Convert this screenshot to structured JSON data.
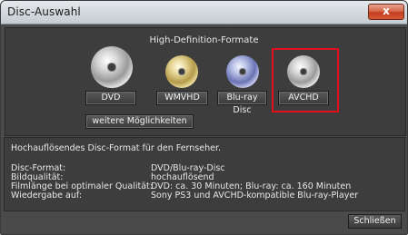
{
  "window": {
    "title": "Disc-Auswahl",
    "close_glyph": "x"
  },
  "formats": {
    "group_label": "High-Definition-Formate",
    "items": [
      {
        "label": "DVD",
        "icon": "silver-disc-icon"
      },
      {
        "label": "WMVHD",
        "icon": "gold-disc-icon"
      },
      {
        "label": "Blu-ray Disc",
        "icon": "blue-disc-icon"
      },
      {
        "label": "AVCHD",
        "icon": "silver-disc-icon",
        "selected": true
      }
    ],
    "more_label": "weitere Möglichkeiten",
    "highlight_color": "#e0101a"
  },
  "info": {
    "description": "Hochauflösendes Disc-Format für den Fernseher.",
    "rows": [
      {
        "label": "Disc-Format:",
        "value": "DVD/Blu-ray-Disc"
      },
      {
        "label": "Bildqualität:",
        "value": "hochauflösend"
      },
      {
        "label": "Filmlänge bei optimaler Qualität:",
        "value": "DVD: ca. 30 Minuten; Blu-ray: ca. 160 Minuten"
      },
      {
        "label": "Wiedergabe auf:",
        "value": "Sony PS3 und AVCHD-kompatible Blu-ray-Player"
      }
    ]
  },
  "footer": {
    "close_label": "Schließen"
  }
}
